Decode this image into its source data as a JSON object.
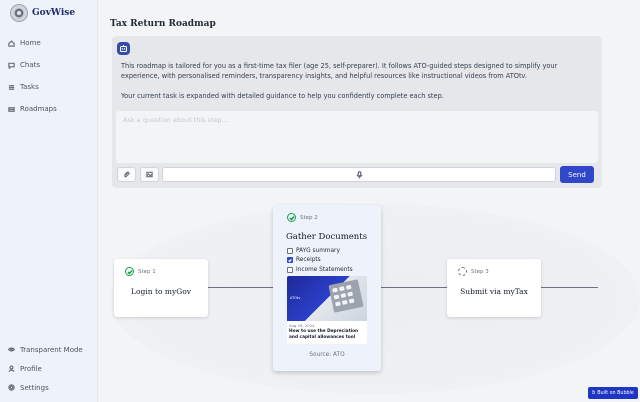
{
  "brand": {
    "name": "GovWise"
  },
  "nav": {
    "items": [
      {
        "label": "Home",
        "icon": "home-icon"
      },
      {
        "label": "Chats",
        "icon": "chat-icon"
      },
      {
        "label": "Tasks",
        "icon": "tasks-icon"
      },
      {
        "label": "Roadmaps",
        "icon": "roadmap-icon"
      }
    ],
    "bottom": [
      {
        "label": "Transparent Mode",
        "icon": "eye-icon"
      },
      {
        "label": "Profile",
        "icon": "user-icon"
      },
      {
        "label": "Settings",
        "icon": "gear-icon"
      }
    ]
  },
  "page": {
    "title": "Tax Return Roadmap"
  },
  "assistant": {
    "message_1": "This roadmap is tailored for you as a first-time tax filer (age 25, self-preparer). It follows ATO-guided steps designed to simplify your experience, with personalised reminders, transparency insights, and helpful resources like instructional videos from ATOtv.",
    "message_2": "Your current task is expanded with detailed guidance to help you confidently complete each step."
  },
  "composer": {
    "placeholder": "Ask a question about this step...",
    "send_label": "Send"
  },
  "steps": [
    {
      "tag": "Step 1",
      "title": "Login to myGov",
      "status": "complete"
    },
    {
      "tag": "Step 2",
      "title": "Gather Documents",
      "status": "active",
      "checklist": [
        {
          "label": "PAYG summary",
          "checked": false
        },
        {
          "label": "Receipts",
          "checked": true
        },
        {
          "label": "Income Statements",
          "checked": false
        }
      ],
      "video": {
        "thumb_text": "ATOtv",
        "date": "Aug 16, 2024",
        "title": "How to use the Depreciation and capital allowances tool"
      },
      "source": "Source: ATO"
    },
    {
      "tag": "Step 3",
      "title": "Submit via myTax",
      "status": "pending"
    }
  ],
  "badge": {
    "label": "Built on Bubble"
  }
}
